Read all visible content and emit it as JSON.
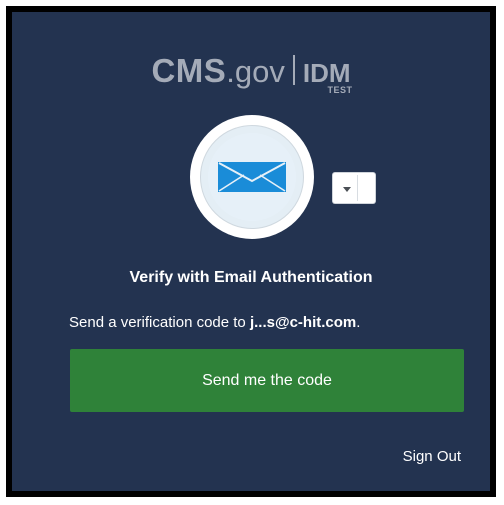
{
  "logo": {
    "cms": "CMS",
    "gov": ".gov",
    "idm": "IDM",
    "test": "TEST"
  },
  "factor": {
    "icon": "envelope-icon",
    "menu_icon": "caret-down-icon"
  },
  "title": "Verify with Email Authentication",
  "send_prefix": "Send a verification code to ",
  "email": "j...s@c-hit.com",
  "send_suffix": ".",
  "button_label": "Send me the code",
  "sign_out": "Sign Out",
  "colors": {
    "panel": "#233350",
    "button": "#2f8239",
    "envelope": "#1a8cd8",
    "logo": "#a4abb8"
  }
}
